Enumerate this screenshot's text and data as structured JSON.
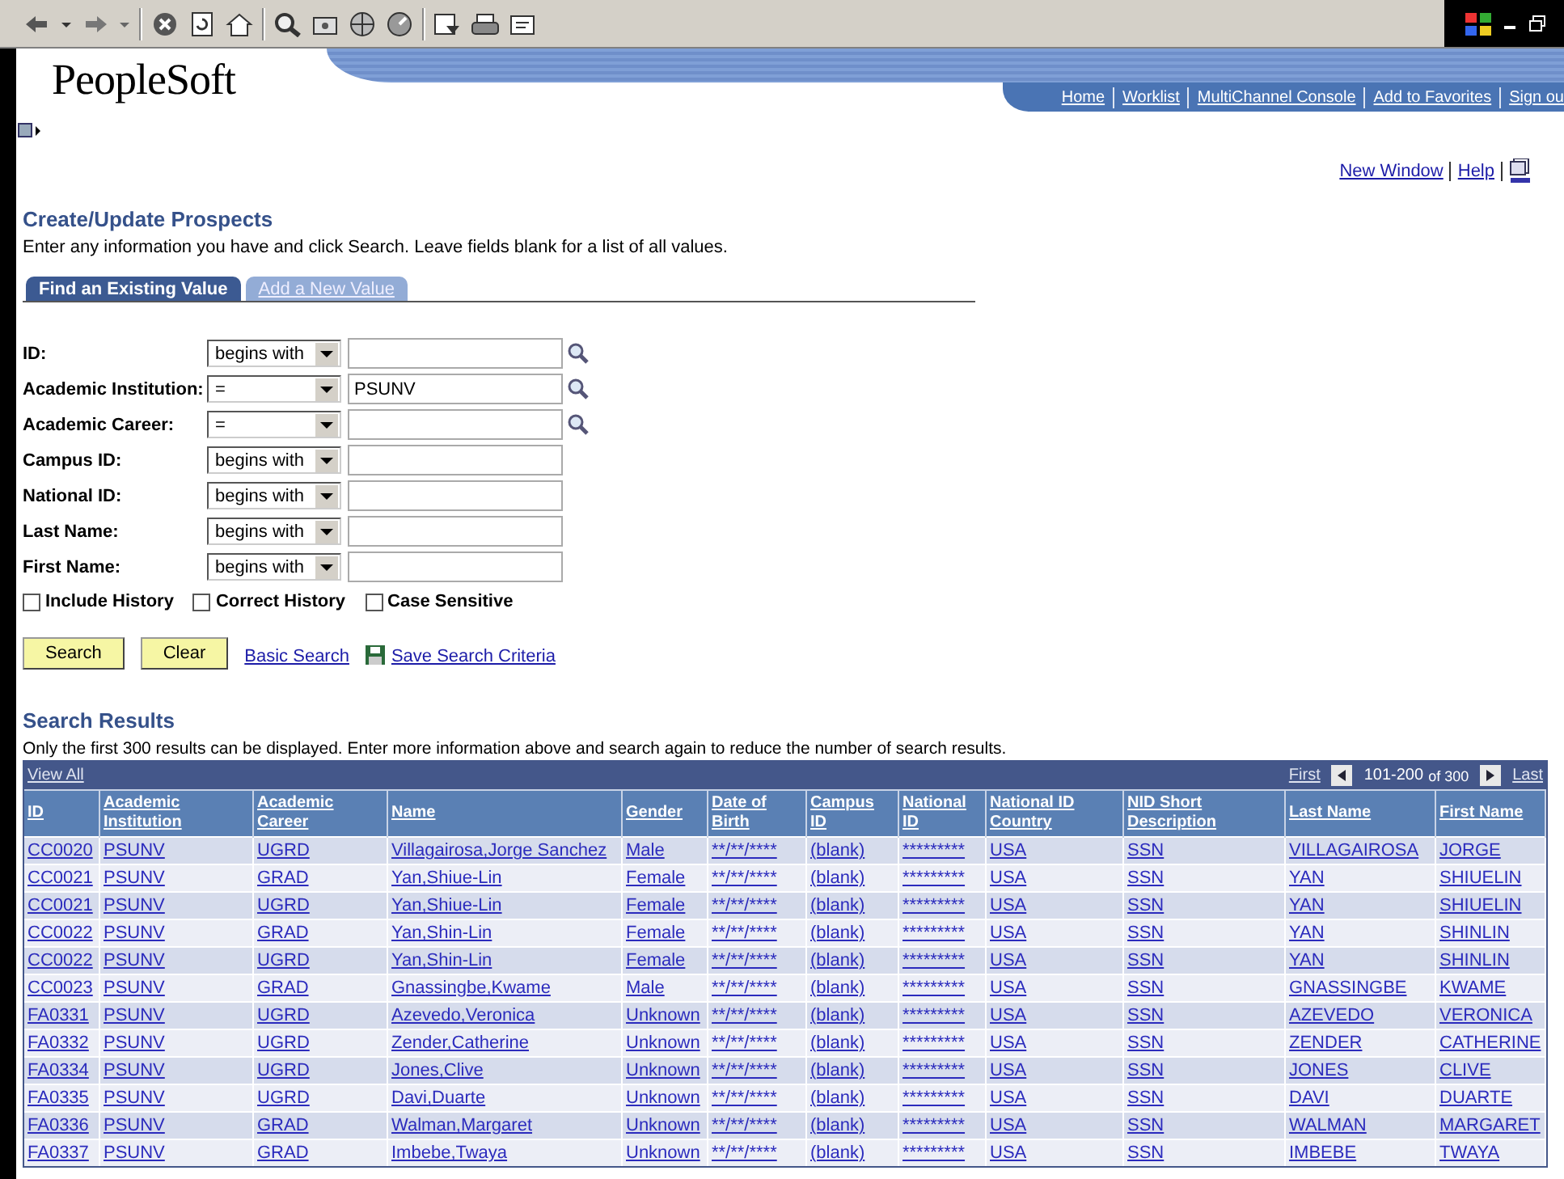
{
  "header": {
    "logo": "PeopleSoft",
    "nav_links": [
      "Home",
      "Worklist",
      "MultiChannel Console",
      "Add to Favorites",
      "Sign ou"
    ]
  },
  "utility_links": [
    "New Window",
    "Help"
  ],
  "page": {
    "title": "Create/Update Prospects",
    "instructions": "Enter any information you have and click Search. Leave fields blank for a list of all values."
  },
  "tabs": [
    {
      "label": "Find an Existing Value",
      "selected": true
    },
    {
      "label": "Add a New Value",
      "selected": false
    }
  ],
  "criteria": [
    {
      "label": "ID:",
      "operator": "begins with",
      "lookup": true
    },
    {
      "label": "Academic Institution:",
      "operator": "=",
      "value": "PSUNV",
      "lookup": true
    },
    {
      "label": "Academic Career:",
      "operator": "=",
      "lookup": true
    },
    {
      "label": "Campus ID:",
      "operator": "begins with",
      "lookup": false
    },
    {
      "label": "National ID:",
      "operator": "begins with",
      "lookup": false
    },
    {
      "label": "Last Name:",
      "operator": "begins with",
      "lookup": false
    },
    {
      "label": "First Name:",
      "operator": "begins with",
      "lookup": false
    }
  ],
  "options": [
    {
      "label": "Include History",
      "checked": false
    },
    {
      "label": "Correct History",
      "checked": false
    },
    {
      "label": "Case Sensitive",
      "checked": false
    }
  ],
  "buttons": [
    "Search",
    "Clear"
  ],
  "links": [
    "Basic Search",
    "Save Search Criteria"
  ],
  "results": {
    "title": "Search Results",
    "note": "Only the first 300 results can be displayed. Enter more information above and search again to reduce the number of search results.",
    "view_all": "View All",
    "pagination": {
      "first": "First",
      "range": "101-200",
      "total": "of 300",
      "last": "Last"
    },
    "columns": [
      "ID",
      "Academic Institution",
      "Academic Career",
      "Name",
      "Gender",
      "Date of Birth",
      "Campus ID",
      "National ID",
      "National ID Country",
      "NID Short Description",
      "Last Name",
      "First Name"
    ],
    "rows": [
      [
        "CC0020",
        "PSUNV",
        "UGRD",
        "Villagairosa,Jorge Sanchez",
        "Male",
        "**/**/****",
        "(blank)",
        "*********",
        "USA",
        "SSN",
        "VILLAGAIROSA",
        "JORGE"
      ],
      [
        "CC0021",
        "PSUNV",
        "GRAD",
        "Yan,Shiue-Lin",
        "Female",
        "**/**/****",
        "(blank)",
        "*********",
        "USA",
        "SSN",
        "YAN",
        "SHIUELIN"
      ],
      [
        "CC0021",
        "PSUNV",
        "UGRD",
        "Yan,Shiue-Lin",
        "Female",
        "**/**/****",
        "(blank)",
        "*********",
        "USA",
        "SSN",
        "YAN",
        "SHIUELIN"
      ],
      [
        "CC0022",
        "PSUNV",
        "GRAD",
        "Yan,Shin-Lin",
        "Female",
        "**/**/****",
        "(blank)",
        "*********",
        "USA",
        "SSN",
        "YAN",
        "SHINLIN"
      ],
      [
        "CC0022",
        "PSUNV",
        "UGRD",
        "Yan,Shin-Lin",
        "Female",
        "**/**/****",
        "(blank)",
        "*********",
        "USA",
        "SSN",
        "YAN",
        "SHINLIN"
      ],
      [
        "CC0023",
        "PSUNV",
        "GRAD",
        "Gnassingbe,Kwame",
        "Male",
        "**/**/****",
        "(blank)",
        "*********",
        "USA",
        "SSN",
        "GNASSINGBE",
        "KWAME"
      ],
      [
        "FA0331",
        "PSUNV",
        "UGRD",
        "Azevedo,Veronica",
        "Unknown",
        "**/**/****",
        "(blank)",
        "*********",
        "USA",
        "SSN",
        "AZEVEDO",
        "VERONICA"
      ],
      [
        "FA0332",
        "PSUNV",
        "UGRD",
        "Zender,Catherine",
        "Unknown",
        "**/**/****",
        "(blank)",
        "*********",
        "USA",
        "SSN",
        "ZENDER",
        "CATHERINE"
      ],
      [
        "FA0334",
        "PSUNV",
        "UGRD",
        "Jones,Clive",
        "Unknown",
        "**/**/****",
        "(blank)",
        "*********",
        "USA",
        "SSN",
        "JONES",
        "CLIVE"
      ],
      [
        "FA0335",
        "PSUNV",
        "UGRD",
        "Davi,Duarte",
        "Unknown",
        "**/**/****",
        "(blank)",
        "*********",
        "USA",
        "SSN",
        "DAVI",
        "DUARTE"
      ],
      [
        "FA0336",
        "PSUNV",
        "GRAD",
        "Walman,Margaret",
        "Unknown",
        "**/**/****",
        "(blank)",
        "*********",
        "USA",
        "SSN",
        "WALMAN",
        "MARGARET"
      ],
      [
        "FA0337",
        "PSUNV",
        "GRAD",
        "Imbebe,Twaya",
        "Unknown",
        "**/**/****",
        "(blank)",
        "*********",
        "USA",
        "SSN",
        "IMBEBE",
        "TWAYA"
      ]
    ]
  }
}
